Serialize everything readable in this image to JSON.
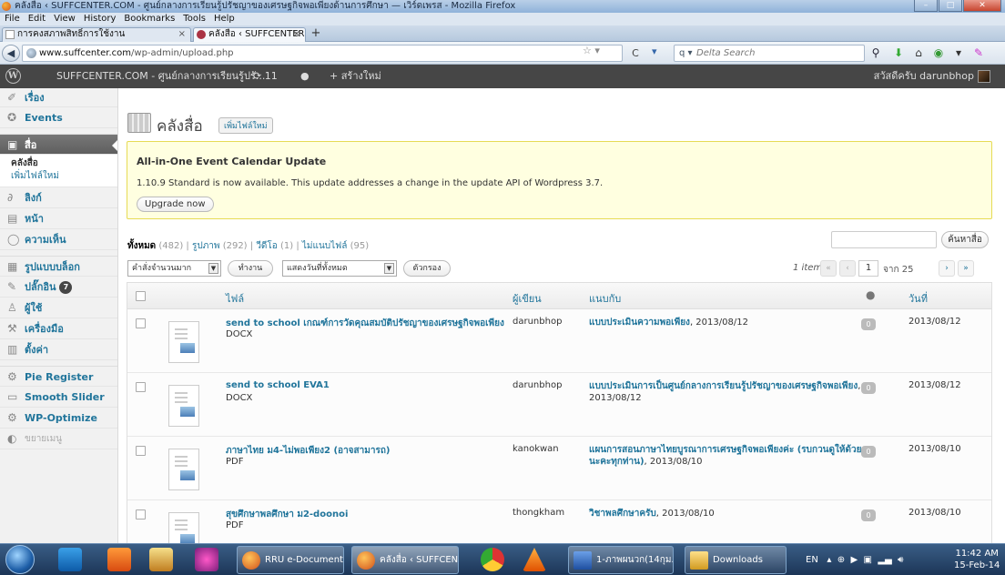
{
  "window": {
    "title": "คลังสื่อ ‹ SUFFCENTER.COM - ศูนย์กลางการเรียนรู้ปรัชญาของเศรษฐกิจพอเพียงด้านการศึกษา — เวิร์ดเพรส - Mozilla Firefox"
  },
  "menu": [
    "File",
    "Edit",
    "View",
    "History",
    "Bookmarks",
    "Tools",
    "Help"
  ],
  "tabs": [
    {
      "label": "การคงสภาพสิทธิ์การใช้งาน",
      "active": false
    },
    {
      "label": "คลังสื่อ ‹ SUFFCENTER.COM - ศูน...",
      "active": true
    }
  ],
  "nav": {
    "url_host": "www.suffcenter.com",
    "url_path": "/wp-admin/upload.php",
    "search_placeholder": "Delta Search"
  },
  "adminbar": {
    "site": "SUFFCENTER.COM - ศูนย์กลางการเรียนรู้ปรั...",
    "updates": "11",
    "new": "สร้างใหม่",
    "greeting": "สวัสดีครับ darunbhop"
  },
  "sidebar": {
    "items": [
      {
        "label": "เรื่อง",
        "icon": "pushpin-icon"
      },
      {
        "label": "Events",
        "icon": "events-icon"
      },
      {
        "label": "สื่อ",
        "icon": "media-icon",
        "current": true
      },
      {
        "label": "ลิงก์",
        "icon": "link-icon"
      },
      {
        "label": "หน้า",
        "icon": "page-icon"
      },
      {
        "label": "ความเห็น",
        "icon": "comment-icon"
      },
      {
        "label": "รูปแบบบล็อก",
        "icon": "appearance-icon"
      },
      {
        "label": "ปลั๊กอิน",
        "icon": "plugin-icon",
        "badge": "7"
      },
      {
        "label": "ผู้ใช้",
        "icon": "users-icon"
      },
      {
        "label": "เครื่องมือ",
        "icon": "tools-icon"
      },
      {
        "label": "ตั้งค่า",
        "icon": "settings-icon"
      },
      {
        "label": "Pie Register",
        "icon": "plugin-gear-icon"
      },
      {
        "label": "Smooth Slider",
        "icon": "slider-icon"
      },
      {
        "label": "WP-Optimize",
        "icon": "plugin-gear-icon"
      }
    ],
    "submenu": [
      "คลังสื่อ",
      "เพิ่มไฟล์ใหม่"
    ],
    "collapse": "ขยายเมนู"
  },
  "page": {
    "title": "คลังสื่อ",
    "add_new": "เพิ่มไฟล์ใหม่"
  },
  "notice": {
    "title": "All-in-One Event Calendar Update",
    "message": "1.10.9 Standard is now available. This update addresses a change in the update API of Wordpress 3.7.",
    "button": "Upgrade now"
  },
  "filters": [
    {
      "label": "ทั้งหมด",
      "count": "(482)",
      "current": true
    },
    {
      "label": "รูปภาพ",
      "count": "(292)"
    },
    {
      "label": "วีดีโอ",
      "count": "(1)"
    },
    {
      "label": "ไม่แนบไฟล์",
      "count": "(95)"
    }
  ],
  "search_button": "ค้นหาสื่อ",
  "bulk": {
    "select": "คำสั่งจำนวนมาก",
    "apply": "ทำงาน",
    "date_select": "แสดงวันที่ทั้งหมด",
    "filter": "ตัวกรอง"
  },
  "pager": {
    "items": "1 item",
    "first": "«",
    "prev": "‹",
    "current": "1",
    "of": "จาก 25",
    "next": "›",
    "last": "»"
  },
  "table": {
    "headers": {
      "file": "ไฟล์",
      "author": "ผู้เขียน",
      "attached": "แนบกับ",
      "date": "วันที่"
    },
    "rows": [
      {
        "title": "send to school เกณฑ์การวัดคุณสมบัติปรัชญาของเศรษฐกิจพอเพียง",
        "ext": "DOCX",
        "author": "darunbhop",
        "attached_post": "แบบประเมินความพอเพียง",
        "attached_date": ", 2013/08/12",
        "comments": "0",
        "date": "2013/08/12"
      },
      {
        "title": "send to school EVA1",
        "ext": "DOCX",
        "author": "darunbhop",
        "attached_post": "แบบประเมินการเป็นศูนย์กลางการเรียนรู้ปรัชญาของเศรษฐกิจพอเพียง",
        "attached_date": ", 2013/08/12",
        "comments": "0",
        "date": "2013/08/12"
      },
      {
        "title": "ภาษาไทย ม4-ไม่พอเพียง2 (อาจสามารถ)",
        "ext": "PDF",
        "author": "kanokwan",
        "attached_post": "แผนการสอนภาษาไทยบูรณาการเศรษฐกิจพอเพียงค่ะ (รบกวนดูให้ด้วยนะคะทุกท่าน)",
        "attached_date": ", 2013/08/10",
        "comments": "0",
        "date": "2013/08/10"
      },
      {
        "title": "สุขศึกษาพลศึกษา ม2-doonoi",
        "ext": "PDF",
        "author": "thongkham",
        "attached_post": "วิชาพลศึกษาครับ",
        "attached_date": ", 2013/08/10",
        "comments": "0",
        "date": "2013/08/10"
      }
    ]
  },
  "taskbar": {
    "buttons": [
      {
        "label": "RRU e-Document..."
      },
      {
        "label": "คลังสื่อ ‹ SUFFCEN...",
        "active": true
      },
      {
        "label": "1-ภาพผนวก(14กุม..."
      },
      {
        "label": "Downloads"
      }
    ],
    "lang": "EN",
    "time": "11:42 AM",
    "date": "15-Feb-14"
  },
  "colors": {
    "wp_link": "#21759b",
    "adminbar": "#464646",
    "notice_bg": "#ffffe0"
  }
}
